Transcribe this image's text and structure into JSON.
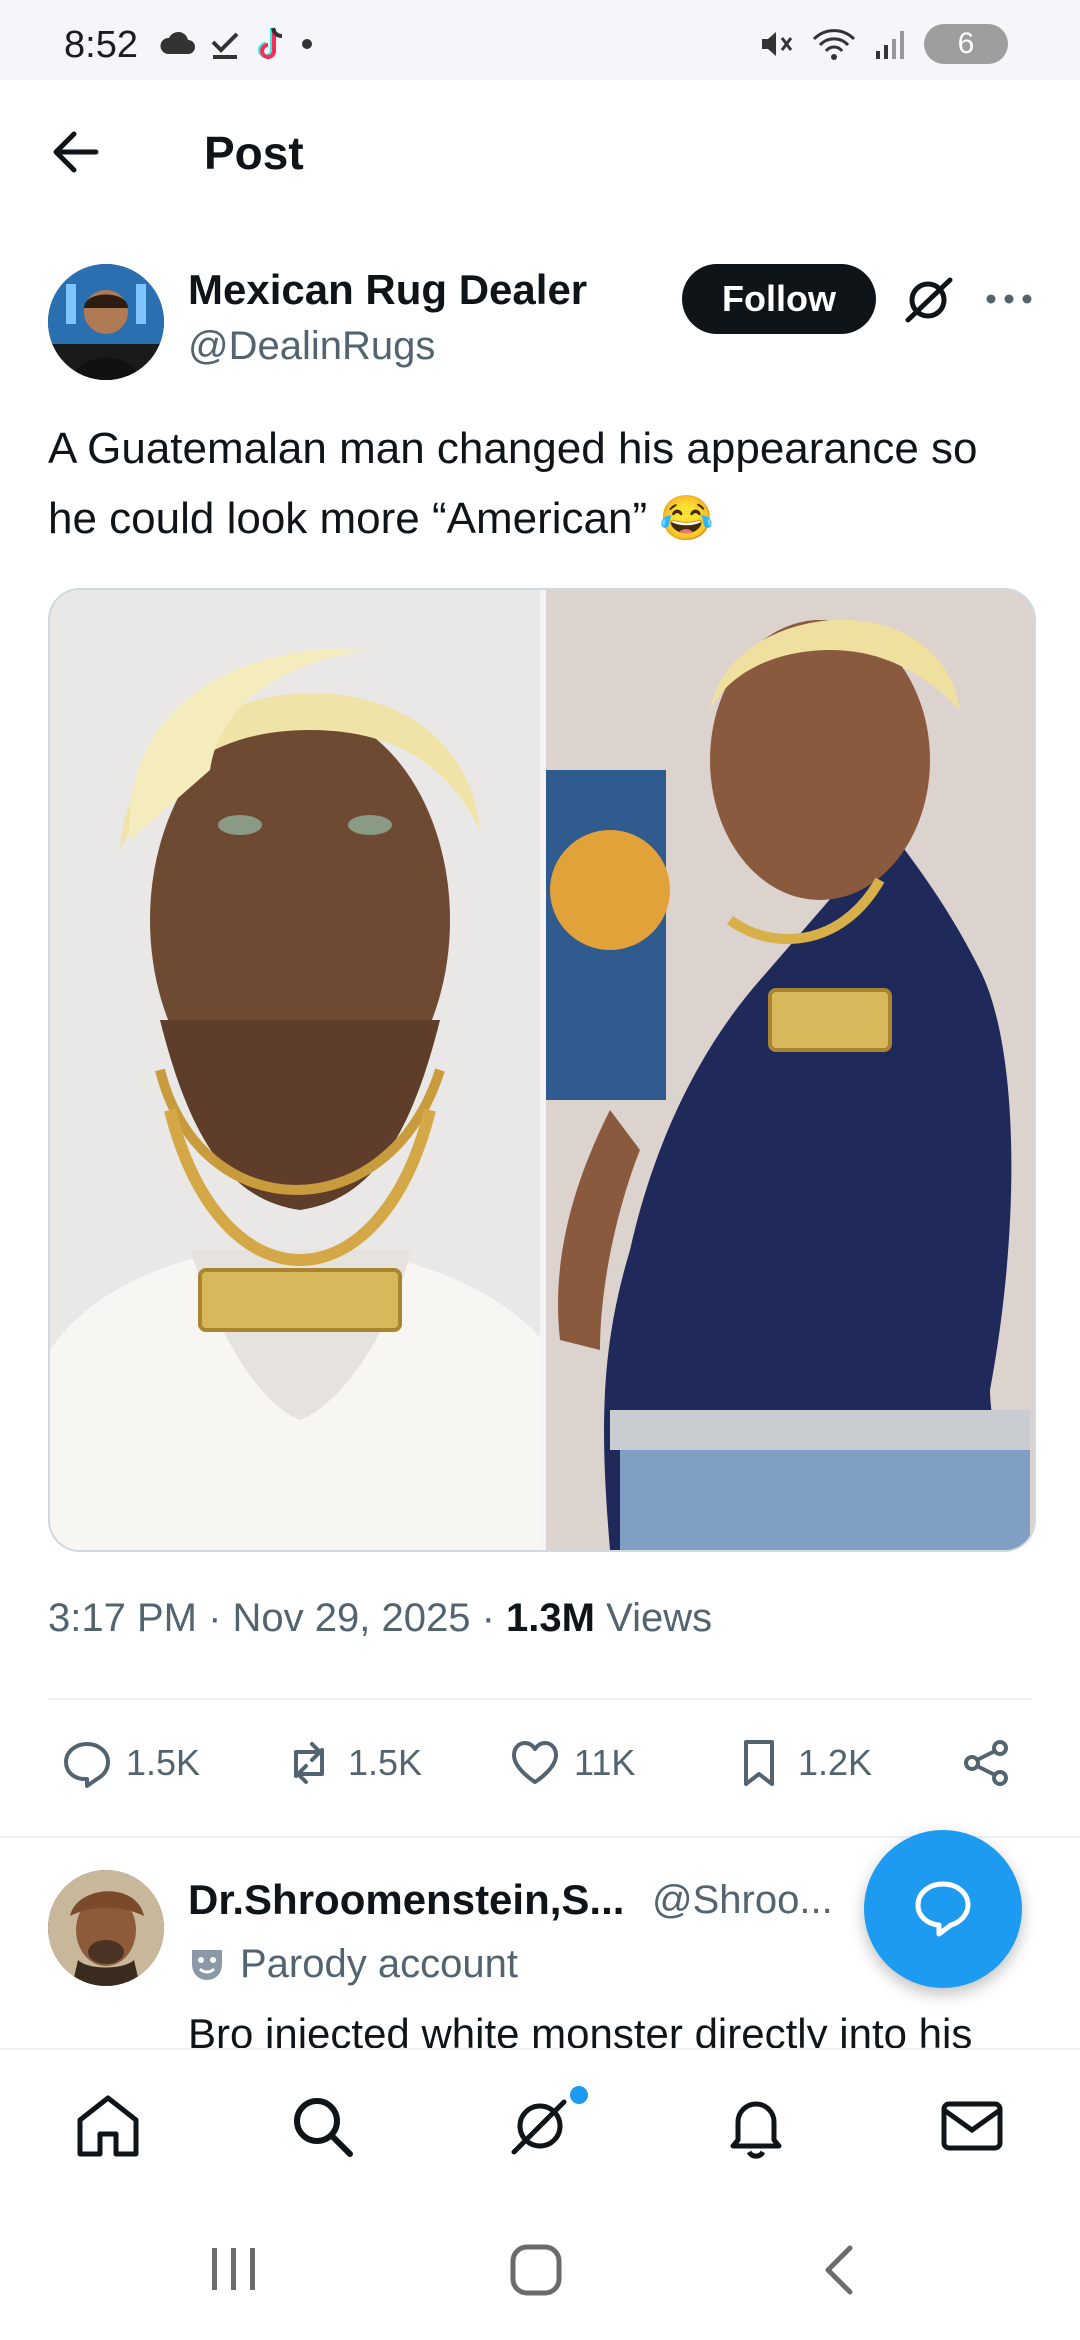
{
  "status_bar": {
    "time": "8:52",
    "battery": "6"
  },
  "header": {
    "title": "Post"
  },
  "post": {
    "author_name": "Mexican Rug Dealer",
    "author_handle": "@DealinRugs",
    "follow_label": "Follow",
    "text": "A Guatemalan man changed his appearance so he could look more “American” 😂",
    "time": "3:17 PM",
    "date": "Nov 29, 2025",
    "views_count": "1.3M",
    "views_label": "Views",
    "replies": "1.5K",
    "reposts": "1.5K",
    "likes": "11K",
    "bookmarks": "1.2K"
  },
  "reply": {
    "name": "Dr.Shroomenstein,S...",
    "handle": "@Shroo...",
    "badge": "Parody account",
    "text": "Bro injected white monster directly into his"
  },
  "colors": {
    "accent": "#1d9bf0",
    "text": "#0f1419",
    "muted": "#536471"
  }
}
